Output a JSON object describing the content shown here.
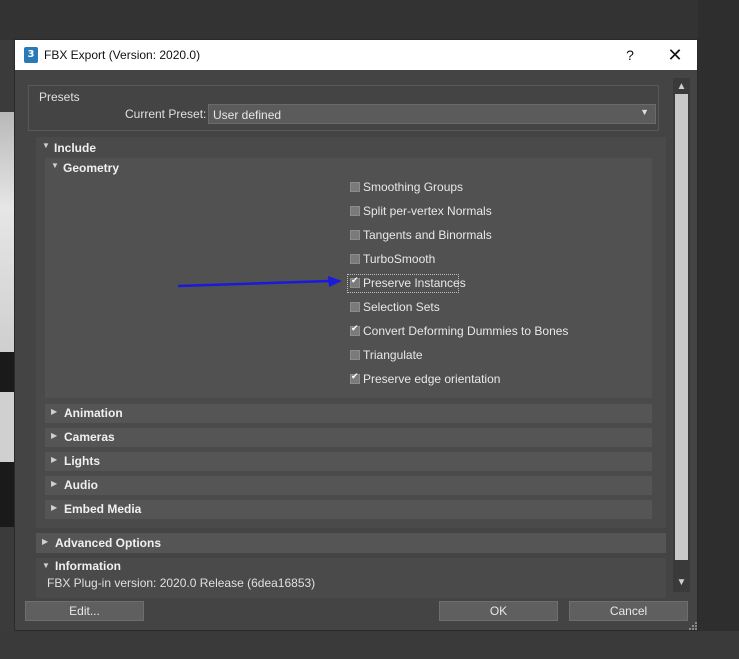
{
  "window": {
    "title": "FBX Export (Version: 2020.0)",
    "icon_label": "3",
    "help_symbol": "?",
    "close_symbol": "✕"
  },
  "presets": {
    "group_label": "Presets",
    "current_preset_label": "Current Preset:",
    "current_preset_value": "User defined"
  },
  "include": {
    "label": "Include",
    "geometry": {
      "label": "Geometry",
      "options": [
        {
          "label": "Smoothing Groups",
          "checked": false
        },
        {
          "label": "Split per-vertex Normals",
          "checked": false
        },
        {
          "label": "Tangents and Binormals",
          "checked": false
        },
        {
          "label": "TurboSmooth",
          "checked": false
        },
        {
          "label": "Preserve Instances",
          "checked": true
        },
        {
          "label": "Selection Sets",
          "checked": false
        },
        {
          "label": "Convert Deforming Dummies to Bones",
          "checked": true
        },
        {
          "label": "Triangulate",
          "checked": false
        },
        {
          "label": "Preserve edge orientation",
          "checked": true
        }
      ]
    },
    "sub_sections": [
      "Animation",
      "Cameras",
      "Lights",
      "Audio",
      "Embed Media"
    ]
  },
  "advanced_options": {
    "label": "Advanced Options"
  },
  "information": {
    "label": "Information",
    "plugin_version": "FBX Plug-in version: 2020.0 Release (6dea16853)"
  },
  "buttons": {
    "edit": "Edit...",
    "ok": "OK",
    "cancel": "Cancel"
  },
  "annotation": {
    "color": "#1a1adc"
  }
}
